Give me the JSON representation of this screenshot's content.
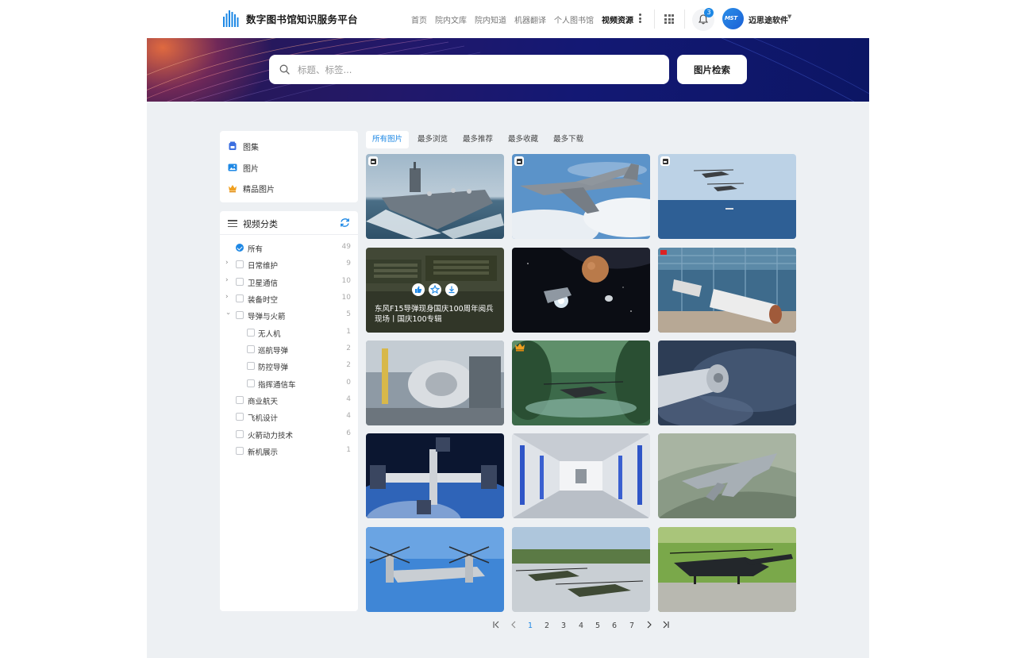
{
  "header": {
    "title": "数字图书馆知识服务平台",
    "nav": [
      "首页",
      "院内文库",
      "院内知道",
      "机器翻译",
      "个人图书馆",
      "视频资源"
    ],
    "active_nav": "视频资源",
    "notification_count": "3",
    "avatar_text": "MST",
    "user_name": "迈思途软件",
    "accent_color": "#1e88e5"
  },
  "search": {
    "placeholder": "标题、标签...",
    "button_label": "图片检索"
  },
  "quick_links": [
    {
      "label": "图集",
      "icon": "album-icon"
    },
    {
      "label": "图片",
      "icon": "image-icon"
    },
    {
      "label": "精品图片",
      "icon": "crown-icon"
    }
  ],
  "category_panel": {
    "title": "视频分类",
    "items": [
      {
        "label": "所有",
        "count": "49",
        "checked": true
      },
      {
        "label": "日常维护",
        "count": "9",
        "expandable": true
      },
      {
        "label": "卫星通信",
        "count": "10",
        "expandable": true
      },
      {
        "label": "装备时空",
        "count": "10",
        "expandable": true
      },
      {
        "label": "导弹与火箭",
        "count": "5",
        "expanded": true
      },
      {
        "label": "无人机",
        "count": "1",
        "child": true
      },
      {
        "label": "巡航导弹",
        "count": "2",
        "child": true
      },
      {
        "label": "防控导弹",
        "count": "2",
        "child": true
      },
      {
        "label": "指挥通信车",
        "count": "0",
        "child": true
      },
      {
        "label": "商业航天",
        "count": "4"
      },
      {
        "label": "飞机设计",
        "count": "4"
      },
      {
        "label": "火箭动力技术",
        "count": "6"
      },
      {
        "label": "新机展示",
        "count": "1"
      }
    ]
  },
  "tabs": [
    "所有图片",
    "最多浏览",
    "最多推荐",
    "最多收藏",
    "最多下载"
  ],
  "hovered_image": {
    "caption": "东风F15导弹现身国庆100周年阅兵现场丨国庆100专辑"
  },
  "images": [
    {
      "subject": "aircraft-carrier",
      "tag": "album"
    },
    {
      "subject": "transport-plane",
      "tag": "album"
    },
    {
      "subject": "helicopters-over-sea",
      "tag": "album"
    },
    {
      "subject": "missile-launchers",
      "hovered": true
    },
    {
      "subject": "space-probe-planet"
    },
    {
      "subject": "rocket-factory"
    },
    {
      "subject": "industrial-plant"
    },
    {
      "subject": "attack-helicopter-forest",
      "tag": "premium"
    },
    {
      "subject": "spacecraft-orbit"
    },
    {
      "subject": "space-station"
    },
    {
      "subject": "station-interior"
    },
    {
      "subject": "stealth-fighter"
    },
    {
      "subject": "tiltrotor"
    },
    {
      "subject": "helicopters-airfield"
    },
    {
      "subject": "helicopter-runway"
    }
  ],
  "pagination": {
    "pages": [
      "1",
      "2",
      "3",
      "4",
      "5",
      "6",
      "7"
    ],
    "current": "1"
  }
}
